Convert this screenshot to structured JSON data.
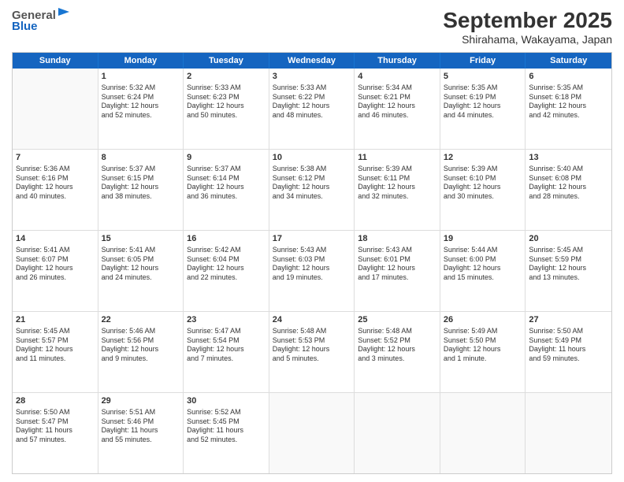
{
  "header": {
    "logo_general": "General",
    "logo_blue": "Blue",
    "title": "September 2025",
    "subtitle": "Shirahama, Wakayama, Japan"
  },
  "days_of_week": [
    "Sunday",
    "Monday",
    "Tuesday",
    "Wednesday",
    "Thursday",
    "Friday",
    "Saturday"
  ],
  "weeks": [
    [
      {
        "day": "",
        "info": ""
      },
      {
        "day": "1",
        "info": "Sunrise: 5:32 AM\nSunset: 6:24 PM\nDaylight: 12 hours\nand 52 minutes."
      },
      {
        "day": "2",
        "info": "Sunrise: 5:33 AM\nSunset: 6:23 PM\nDaylight: 12 hours\nand 50 minutes."
      },
      {
        "day": "3",
        "info": "Sunrise: 5:33 AM\nSunset: 6:22 PM\nDaylight: 12 hours\nand 48 minutes."
      },
      {
        "day": "4",
        "info": "Sunrise: 5:34 AM\nSunset: 6:21 PM\nDaylight: 12 hours\nand 46 minutes."
      },
      {
        "day": "5",
        "info": "Sunrise: 5:35 AM\nSunset: 6:19 PM\nDaylight: 12 hours\nand 44 minutes."
      },
      {
        "day": "6",
        "info": "Sunrise: 5:35 AM\nSunset: 6:18 PM\nDaylight: 12 hours\nand 42 minutes."
      }
    ],
    [
      {
        "day": "7",
        "info": "Sunrise: 5:36 AM\nSunset: 6:16 PM\nDaylight: 12 hours\nand 40 minutes."
      },
      {
        "day": "8",
        "info": "Sunrise: 5:37 AM\nSunset: 6:15 PM\nDaylight: 12 hours\nand 38 minutes."
      },
      {
        "day": "9",
        "info": "Sunrise: 5:37 AM\nSunset: 6:14 PM\nDaylight: 12 hours\nand 36 minutes."
      },
      {
        "day": "10",
        "info": "Sunrise: 5:38 AM\nSunset: 6:12 PM\nDaylight: 12 hours\nand 34 minutes."
      },
      {
        "day": "11",
        "info": "Sunrise: 5:39 AM\nSunset: 6:11 PM\nDaylight: 12 hours\nand 32 minutes."
      },
      {
        "day": "12",
        "info": "Sunrise: 5:39 AM\nSunset: 6:10 PM\nDaylight: 12 hours\nand 30 minutes."
      },
      {
        "day": "13",
        "info": "Sunrise: 5:40 AM\nSunset: 6:08 PM\nDaylight: 12 hours\nand 28 minutes."
      }
    ],
    [
      {
        "day": "14",
        "info": "Sunrise: 5:41 AM\nSunset: 6:07 PM\nDaylight: 12 hours\nand 26 minutes."
      },
      {
        "day": "15",
        "info": "Sunrise: 5:41 AM\nSunset: 6:05 PM\nDaylight: 12 hours\nand 24 minutes."
      },
      {
        "day": "16",
        "info": "Sunrise: 5:42 AM\nSunset: 6:04 PM\nDaylight: 12 hours\nand 22 minutes."
      },
      {
        "day": "17",
        "info": "Sunrise: 5:43 AM\nSunset: 6:03 PM\nDaylight: 12 hours\nand 19 minutes."
      },
      {
        "day": "18",
        "info": "Sunrise: 5:43 AM\nSunset: 6:01 PM\nDaylight: 12 hours\nand 17 minutes."
      },
      {
        "day": "19",
        "info": "Sunrise: 5:44 AM\nSunset: 6:00 PM\nDaylight: 12 hours\nand 15 minutes."
      },
      {
        "day": "20",
        "info": "Sunrise: 5:45 AM\nSunset: 5:59 PM\nDaylight: 12 hours\nand 13 minutes."
      }
    ],
    [
      {
        "day": "21",
        "info": "Sunrise: 5:45 AM\nSunset: 5:57 PM\nDaylight: 12 hours\nand 11 minutes."
      },
      {
        "day": "22",
        "info": "Sunrise: 5:46 AM\nSunset: 5:56 PM\nDaylight: 12 hours\nand 9 minutes."
      },
      {
        "day": "23",
        "info": "Sunrise: 5:47 AM\nSunset: 5:54 PM\nDaylight: 12 hours\nand 7 minutes."
      },
      {
        "day": "24",
        "info": "Sunrise: 5:48 AM\nSunset: 5:53 PM\nDaylight: 12 hours\nand 5 minutes."
      },
      {
        "day": "25",
        "info": "Sunrise: 5:48 AM\nSunset: 5:52 PM\nDaylight: 12 hours\nand 3 minutes."
      },
      {
        "day": "26",
        "info": "Sunrise: 5:49 AM\nSunset: 5:50 PM\nDaylight: 12 hours\nand 1 minute."
      },
      {
        "day": "27",
        "info": "Sunrise: 5:50 AM\nSunset: 5:49 PM\nDaylight: 11 hours\nand 59 minutes."
      }
    ],
    [
      {
        "day": "28",
        "info": "Sunrise: 5:50 AM\nSunset: 5:47 PM\nDaylight: 11 hours\nand 57 minutes."
      },
      {
        "day": "29",
        "info": "Sunrise: 5:51 AM\nSunset: 5:46 PM\nDaylight: 11 hours\nand 55 minutes."
      },
      {
        "day": "30",
        "info": "Sunrise: 5:52 AM\nSunset: 5:45 PM\nDaylight: 11 hours\nand 52 minutes."
      },
      {
        "day": "",
        "info": ""
      },
      {
        "day": "",
        "info": ""
      },
      {
        "day": "",
        "info": ""
      },
      {
        "day": "",
        "info": ""
      }
    ]
  ]
}
